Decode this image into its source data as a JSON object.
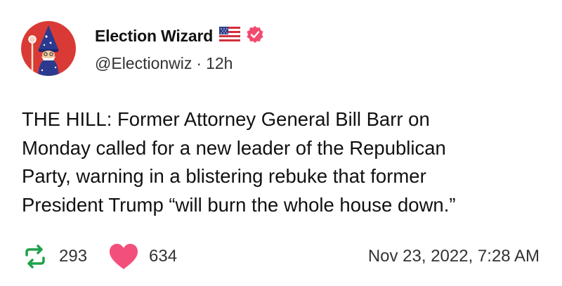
{
  "author": {
    "display_name": "Election Wizard",
    "handle": "@Electionwiz",
    "separator": "·",
    "time_ago": "12h"
  },
  "tweet": {
    "lines": [
      "THE HILL: Former Attorney General Bill Barr on",
      "Monday called for a new leader of the Republican",
      "Party, warning in a blistering rebuke that former",
      "President Trump “will burn the whole house down.”"
    ]
  },
  "stats": {
    "retweets": "293",
    "likes": "634",
    "timestamp": "Nov 23, 2022, 7:28 AM"
  },
  "icons": {
    "avatar": "wizard-avatar",
    "flag": "us-flag-icon",
    "verified": "verified-badge-icon",
    "retweet": "retweet-icon",
    "like": "heart-icon"
  },
  "colors": {
    "avatar_bg": "#d93a36",
    "verified": "#f24a6e",
    "retweet": "#1fa24a",
    "like": "#f34f7c",
    "text": "#111111",
    "muted": "#333333"
  }
}
